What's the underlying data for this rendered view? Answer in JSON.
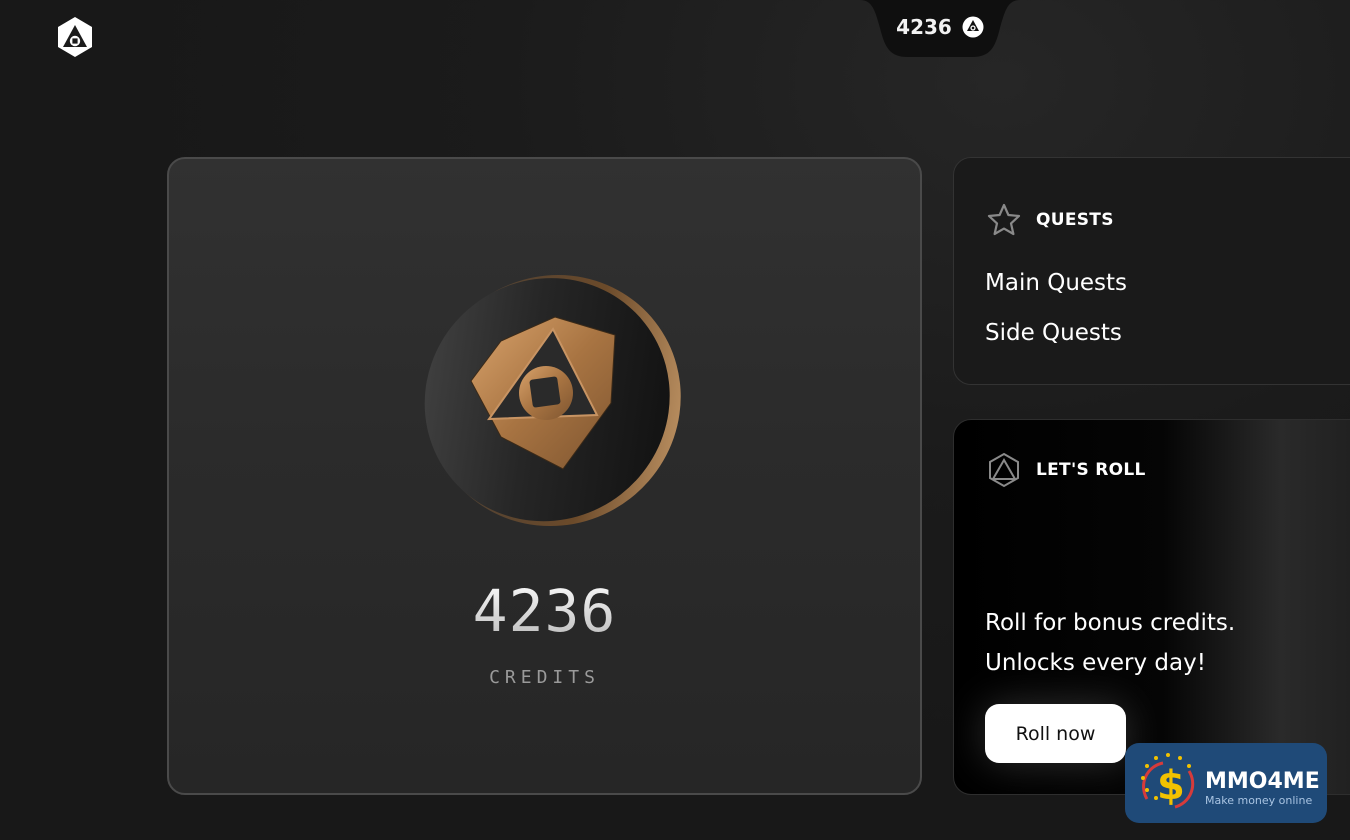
{
  "header": {
    "logo_icon": "hexagon-triangle-logo-icon",
    "balance": "4236",
    "balance_icon": "credit-coin-icon"
  },
  "credits_card": {
    "coin_icon": "gold-hexagon-coin-icon",
    "value": "4236",
    "label": "CREDITS"
  },
  "quests": {
    "icon": "star-icon",
    "title": "QUESTS",
    "items": [
      "Main Quests",
      "Side Quests"
    ]
  },
  "roll": {
    "icon": "dice-icon",
    "title": "LET'S ROLL",
    "line1": "Roll for bonus credits.",
    "line2": "Unlocks every day!",
    "button_label": "Roll now"
  },
  "watermark": {
    "name": "MMO4ME",
    "tagline": "Make money online"
  },
  "colors": {
    "background": "#1b1b1b",
    "card": "#2e2e2e",
    "gold": "#b98550",
    "watermark_bg": "#1f4a78"
  }
}
